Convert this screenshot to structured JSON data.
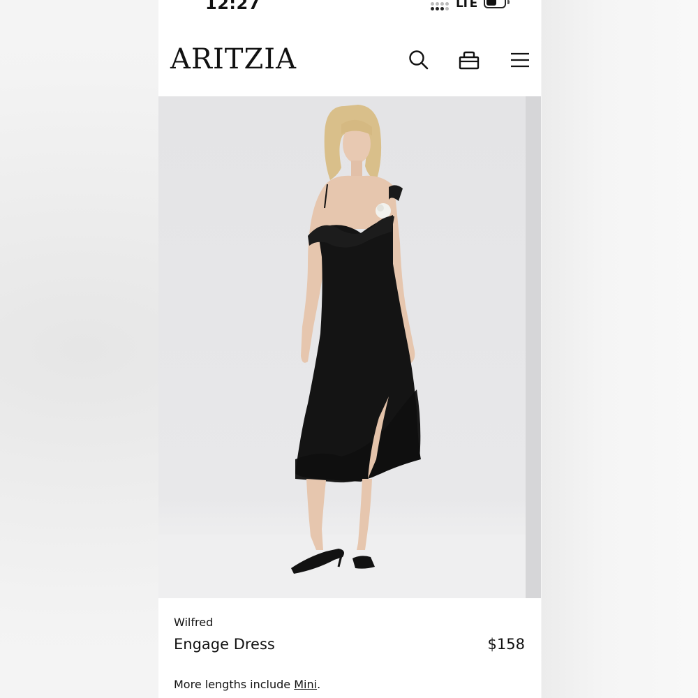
{
  "status_bar": {
    "time": "12:27",
    "network": "LTE",
    "signal_icon": "signal-dots-icon",
    "battery_icon": "battery-icon"
  },
  "header": {
    "logo": "ARITZIA",
    "icons": [
      "search-icon",
      "bag-icon",
      "menu-icon"
    ]
  },
  "hero": {
    "image_subject": "product-photo"
  },
  "product": {
    "brand": "Wilfred",
    "name": "Engage Dress",
    "price": "$158",
    "lengths_prefix": "More lengths include ",
    "lengths_link": "Mini",
    "lengths_suffix": "."
  },
  "colors": {
    "text": "#111111",
    "background": "#ffffff",
    "hero_bg": "#e6e6e8"
  }
}
